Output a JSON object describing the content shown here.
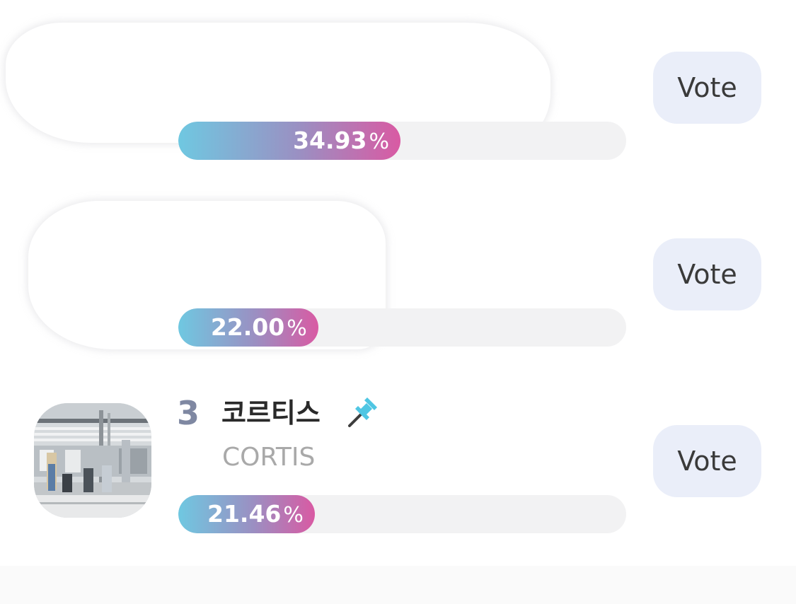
{
  "colors": {
    "rank": "#7f88a2",
    "name": "#2a2a2a",
    "subname": "#a9a9a9",
    "track": "#f2f2f3",
    "gradient_start": "#6fc8e1",
    "gradient_mid": "#9b8fc2",
    "gradient_end": "#d95aa3",
    "vote_bg": "#eaeef9",
    "pin": "#4fc6e3"
  },
  "poll": {
    "items": [
      {
        "redacted": true,
        "percent_value": 34.93,
        "percent_text": "34.93",
        "percent_symbol": "%",
        "vote_label": "Vote"
      },
      {
        "redacted": true,
        "percent_value": 22.0,
        "percent_text": "22.00",
        "percent_symbol": "%",
        "vote_label": "Vote"
      },
      {
        "redacted": false,
        "rank": "3",
        "name": "코르티스",
        "subname": "CORTIS",
        "pinned": true,
        "pin_icon": "pin-icon",
        "percent_value": 21.46,
        "percent_text": "21.46",
        "percent_symbol": "%",
        "vote_label": "Vote"
      }
    ]
  }
}
